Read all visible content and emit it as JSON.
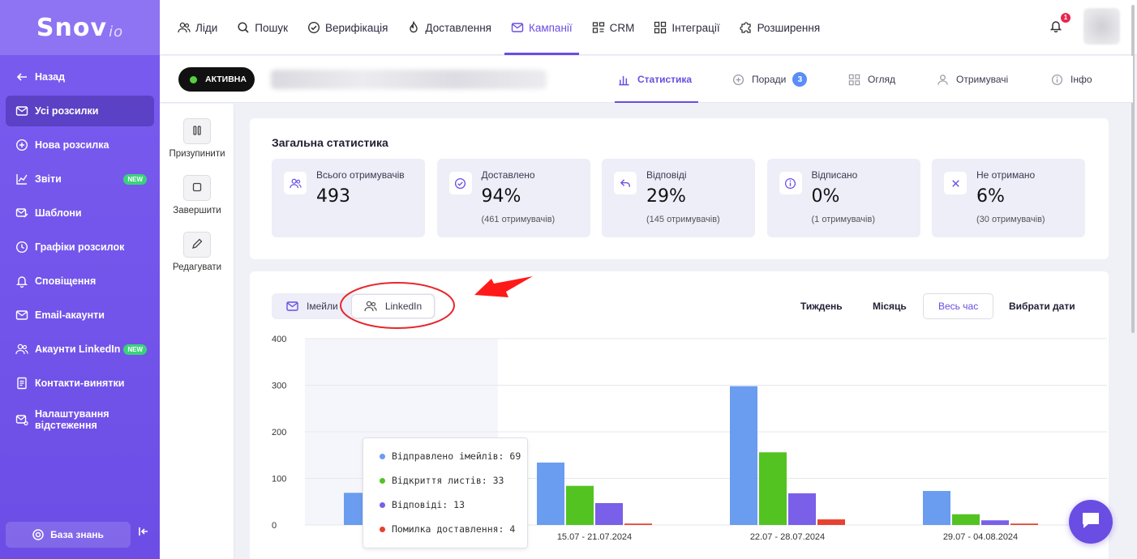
{
  "brand": {
    "logo_main": "Snov",
    "logo_suffix": "io",
    "accent": "#6a4de3"
  },
  "sidebar": {
    "items": [
      {
        "label": "Назад",
        "icon": "arrow-left-icon"
      },
      {
        "label": "Усі розсилки",
        "icon": "mail-icon",
        "active": true
      },
      {
        "label": "Нова розсилка",
        "icon": "plus-circle-icon"
      },
      {
        "label": "Звіти",
        "icon": "chart-icon",
        "badge": "NEW"
      },
      {
        "label": "Шаблони",
        "icon": "mail-edit-icon"
      },
      {
        "label": "Графіки розсилок",
        "icon": "clock-icon"
      },
      {
        "label": "Сповіщення",
        "icon": "bell-icon"
      },
      {
        "label": "Email-акаунти",
        "icon": "mail-icon"
      },
      {
        "label": "Акаунти LinkedIn",
        "icon": "users-icon",
        "badge": "NEW"
      },
      {
        "label": "Контакти-винятки",
        "icon": "document-icon"
      },
      {
        "label": "Налаштування відстеження",
        "icon": "mail-settings-icon"
      }
    ],
    "knowledge_base": "База знань"
  },
  "topnav": {
    "items": [
      {
        "label": "Ліди",
        "icon": "users-icon"
      },
      {
        "label": "Пошук",
        "icon": "search-icon"
      },
      {
        "label": "Верифікація",
        "icon": "check-circle-icon"
      },
      {
        "label": "Доставлення",
        "icon": "flame-icon"
      },
      {
        "label": "Кампанії",
        "icon": "mail-icon",
        "active": true
      },
      {
        "label": "CRM",
        "icon": "crm-icon"
      },
      {
        "label": "Інтеграції",
        "icon": "grid-icon"
      },
      {
        "label": "Розширення",
        "icon": "puzzle-icon"
      }
    ],
    "notifications_count": "1"
  },
  "campaign": {
    "status": "АКТИВНА",
    "tabs": [
      {
        "label": "Статистика",
        "icon": "bar-chart-icon",
        "active": true
      },
      {
        "label": "Поради",
        "icon": "plus-circle-icon",
        "count": "3"
      },
      {
        "label": "Огляд",
        "icon": "grid-icon"
      },
      {
        "label": "Отримувачі",
        "icon": "user-icon"
      },
      {
        "label": "Інфо",
        "icon": "info-icon"
      }
    ]
  },
  "actions": [
    {
      "label": "Призупинити",
      "icon": "pause-icon"
    },
    {
      "label": "Завершити",
      "icon": "stop-icon"
    },
    {
      "label": "Редагувати",
      "icon": "pencil-icon"
    }
  ],
  "stats": {
    "title": "Загальна статистика",
    "boxes": [
      {
        "label": "Всього отримувачів",
        "value": "493",
        "sub": "",
        "icon": "users-icon"
      },
      {
        "label": "Доставлено",
        "value": "94%",
        "sub": "(461 отримувачів)",
        "icon": "check-circle-icon"
      },
      {
        "label": "Відповіді",
        "value": "29%",
        "sub": "(145 отримувачів)",
        "icon": "reply-icon"
      },
      {
        "label": "Відписано",
        "value": "0%",
        "sub": "(1 отримувачів)",
        "icon": "info-icon"
      },
      {
        "label": "Не отримано",
        "value": "6%",
        "sub": "(30 отримувачів)",
        "icon": "close-icon"
      }
    ]
  },
  "chart_controls": {
    "channels": [
      {
        "label": "Імейли",
        "icon": "mail-icon"
      },
      {
        "label": "LinkedIn",
        "icon": "users-icon"
      }
    ],
    "periods": [
      {
        "label": "Тиждень"
      },
      {
        "label": "Місяць"
      },
      {
        "label": "Весь час",
        "active": true
      },
      {
        "label": "Вибрати дати"
      }
    ]
  },
  "tooltip": {
    "rows": [
      {
        "text": "Відправлено імейлів: 69",
        "color": "#6a9cf0"
      },
      {
        "text": "Відкриття листів: 33",
        "color": "#53c322"
      },
      {
        "text": "Відповіді: 13",
        "color": "#7a5fe8"
      },
      {
        "text": "Помилка доставлення: 4",
        "color": "#e8412f"
      }
    ]
  },
  "chart_data": {
    "type": "bar",
    "categories": [
      "",
      "15.07 - 21.07.2024",
      "22.07 - 28.07.2024",
      "29.07 - 04.08.2024"
    ],
    "series": [
      {
        "name": "Відправлено імейлів",
        "color": "#6a9cf0",
        "values": [
          69,
          134,
          298,
          73
        ]
      },
      {
        "name": "Відкриття листів",
        "color": "#53c322",
        "values": [
          33,
          84,
          156,
          23
        ]
      },
      {
        "name": "Відповіді",
        "color": "#7a5fe8",
        "values": [
          13,
          47,
          68,
          10
        ]
      },
      {
        "name": "Помилка доставлення",
        "color": "#e8412f",
        "values": [
          4,
          3,
          12,
          3
        ]
      }
    ],
    "ylim": [
      0,
      400
    ],
    "yticks": [
      0,
      100,
      200,
      300,
      400
    ],
    "grid": true,
    "highlighted_category": 0
  }
}
